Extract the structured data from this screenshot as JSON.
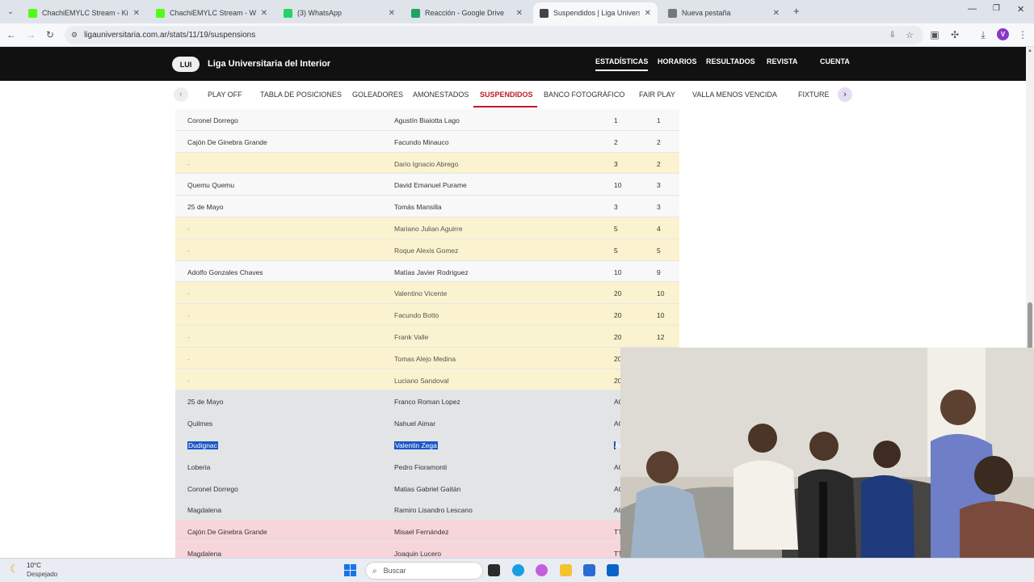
{
  "browser": {
    "tabs": [
      {
        "title": "ChachiEMYLC Stream - Kick Da",
        "icon": "kick-icon",
        "color": "#53fc18"
      },
      {
        "title": "ChachiEMYLC Stream - Watch L",
        "icon": "kick-icon",
        "color": "#53fc18"
      },
      {
        "title": "(3) WhatsApp",
        "icon": "whatsapp-icon",
        "color": "#25d366"
      },
      {
        "title": "Reacción - Google Drive",
        "icon": "google-drive-icon",
        "color": "#1fa463"
      },
      {
        "title": "Suspendidos | Liga Universitaria",
        "icon": "site-icon",
        "color": "#444444"
      },
      {
        "title": "Nueva pestaña",
        "icon": "chrome-icon",
        "color": "#777777"
      }
    ],
    "url": "ligauniversitaria.com.ar/stats/11/19/suspensions",
    "profile_initial": "V"
  },
  "site": {
    "logo_text": "LUI",
    "name": "Liga Universitaria del Interior",
    "nav": [
      "ESTADÍSTICAS",
      "HORARIOS",
      "RESULTADOS",
      "REVISTA",
      "CUENTA"
    ],
    "subnav": [
      "PLAY OFF",
      "TABLA DE POSICIONES",
      "GOLEADORES",
      "AMONESTADOS",
      "SUSPENDIDOS",
      "BANCO FOTOGRÁFICO",
      "FAIR PLAY",
      "VALLA MENOS VENCIDA",
      "FIXTURE"
    ]
  },
  "table": {
    "rows": [
      {
        "team": "Coronel Dorrego",
        "player": "Agustín Biaiotta Lago",
        "a": "1",
        "b": "1",
        "tone": "white"
      },
      {
        "team": "Cajón De Ginebra Grande",
        "player": "Facundo Minauco",
        "a": "2",
        "b": "2",
        "tone": "white"
      },
      {
        "team": "-",
        "player": "Dario Ignacio Abrego",
        "a": "3",
        "b": "2",
        "tone": "yellow"
      },
      {
        "team": "Quemu Quemu",
        "player": "David Emanuel Purame",
        "a": "10",
        "b": "3",
        "tone": "white"
      },
      {
        "team": "25 de Mayo",
        "player": "Tomás Mansilla",
        "a": "3",
        "b": "3",
        "tone": "white"
      },
      {
        "team": "-",
        "player": "Mariano Julian Aguirre",
        "a": "5",
        "b": "4",
        "tone": "yellow"
      },
      {
        "team": "-",
        "player": "Roque Alexis Gomez",
        "a": "5",
        "b": "5",
        "tone": "yellow"
      },
      {
        "team": "Adolfo Gonzales Chaves",
        "player": "Matías Javier Rodriguez",
        "a": "10",
        "b": "9",
        "tone": "white"
      },
      {
        "team": "-",
        "player": "Valentino Vicente",
        "a": "20",
        "b": "10",
        "tone": "yellow"
      },
      {
        "team": "-",
        "player": "Facundo Botto",
        "a": "20",
        "b": "10",
        "tone": "yellow"
      },
      {
        "team": "-",
        "player": "Frank Valle",
        "a": "20",
        "b": "12",
        "tone": "yellow"
      },
      {
        "team": "-",
        "player": "Tomas Alejo Medina",
        "a": "20",
        "b": "",
        "tone": "yellow"
      },
      {
        "team": "-",
        "player": "Luciano Sandoval",
        "a": "20",
        "b": "",
        "tone": "yellow"
      },
      {
        "team": "25 de Mayo",
        "player": "Franco Roman Lopez",
        "a": "AC",
        "b": "",
        "tone": "gray"
      },
      {
        "team": "Quilmes",
        "player": "Nahuel Aimar",
        "a": "AC",
        "b": "",
        "tone": "gray"
      },
      {
        "team": "Dudignac",
        "player": "Valentin Zega",
        "a": "AC",
        "b": "",
        "tone": "gray",
        "selected": true
      },
      {
        "team": "Loberia",
        "player": "Pedro Fioramonti",
        "a": "AC",
        "b": "",
        "tone": "gray"
      },
      {
        "team": "Coronel Dorrego",
        "player": "Matias Gabriel Gaitán",
        "a": "AC",
        "b": "",
        "tone": "gray"
      },
      {
        "team": "Magdalena",
        "player": "Ramiro Lisandro Lescano",
        "a": "AC",
        "b": "",
        "tone": "gray"
      },
      {
        "team": "Cajón De Ginebra Grande",
        "player": "Misael Fernández",
        "a": "TT",
        "b": "",
        "tone": "pink"
      },
      {
        "team": "Magdalena",
        "player": "Joaquin Lucero",
        "a": "TT",
        "b": "",
        "tone": "pink"
      }
    ],
    "tone_colors": {
      "white": "#f8f8f9",
      "yellow": "#fbf3cf",
      "gray": "#e3e4e6",
      "pink": "#f6d6db"
    }
  },
  "taskbar": {
    "weather_temp": "10°C",
    "weather_desc": "Despejado",
    "search_placeholder": "Buscar"
  }
}
